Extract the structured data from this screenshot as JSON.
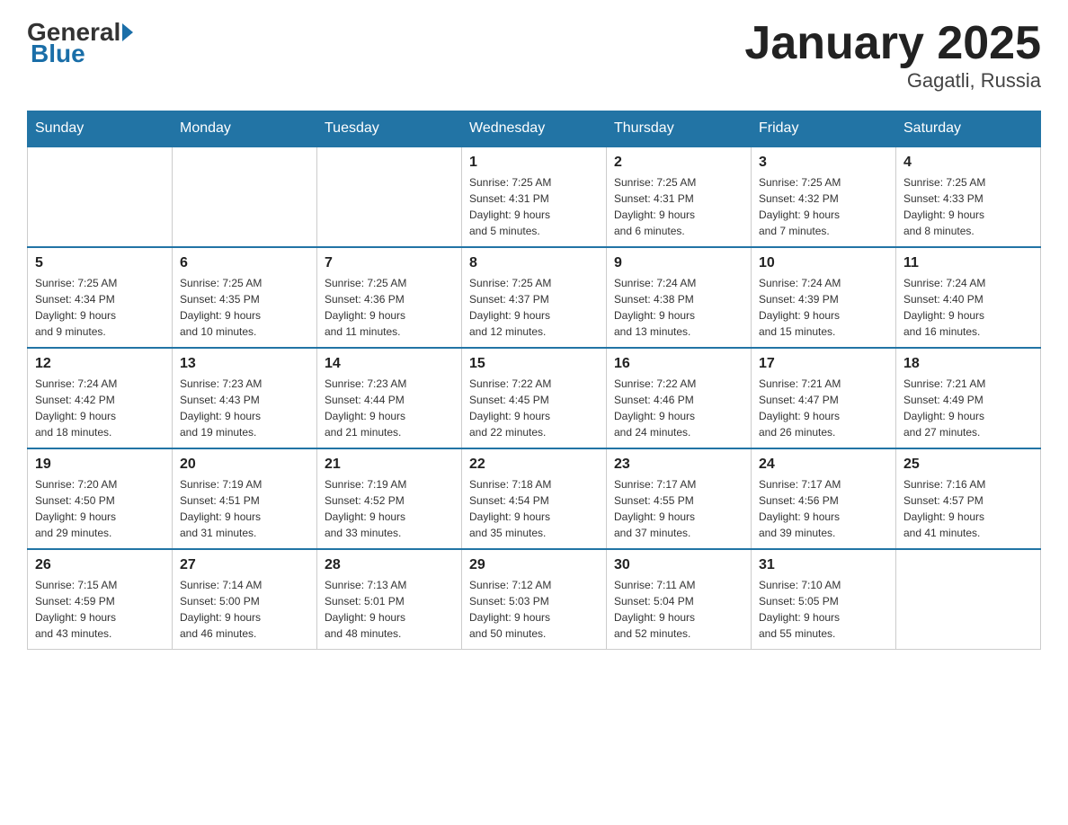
{
  "header": {
    "logo_general": "General",
    "logo_blue": "Blue",
    "month_title": "January 2025",
    "location": "Gagatli, Russia"
  },
  "days_of_week": [
    "Sunday",
    "Monday",
    "Tuesday",
    "Wednesday",
    "Thursday",
    "Friday",
    "Saturday"
  ],
  "weeks": [
    [
      {
        "day": "",
        "info": ""
      },
      {
        "day": "",
        "info": ""
      },
      {
        "day": "",
        "info": ""
      },
      {
        "day": "1",
        "info": "Sunrise: 7:25 AM\nSunset: 4:31 PM\nDaylight: 9 hours\nand 5 minutes."
      },
      {
        "day": "2",
        "info": "Sunrise: 7:25 AM\nSunset: 4:31 PM\nDaylight: 9 hours\nand 6 minutes."
      },
      {
        "day": "3",
        "info": "Sunrise: 7:25 AM\nSunset: 4:32 PM\nDaylight: 9 hours\nand 7 minutes."
      },
      {
        "day": "4",
        "info": "Sunrise: 7:25 AM\nSunset: 4:33 PM\nDaylight: 9 hours\nand 8 minutes."
      }
    ],
    [
      {
        "day": "5",
        "info": "Sunrise: 7:25 AM\nSunset: 4:34 PM\nDaylight: 9 hours\nand 9 minutes."
      },
      {
        "day": "6",
        "info": "Sunrise: 7:25 AM\nSunset: 4:35 PM\nDaylight: 9 hours\nand 10 minutes."
      },
      {
        "day": "7",
        "info": "Sunrise: 7:25 AM\nSunset: 4:36 PM\nDaylight: 9 hours\nand 11 minutes."
      },
      {
        "day": "8",
        "info": "Sunrise: 7:25 AM\nSunset: 4:37 PM\nDaylight: 9 hours\nand 12 minutes."
      },
      {
        "day": "9",
        "info": "Sunrise: 7:24 AM\nSunset: 4:38 PM\nDaylight: 9 hours\nand 13 minutes."
      },
      {
        "day": "10",
        "info": "Sunrise: 7:24 AM\nSunset: 4:39 PM\nDaylight: 9 hours\nand 15 minutes."
      },
      {
        "day": "11",
        "info": "Sunrise: 7:24 AM\nSunset: 4:40 PM\nDaylight: 9 hours\nand 16 minutes."
      }
    ],
    [
      {
        "day": "12",
        "info": "Sunrise: 7:24 AM\nSunset: 4:42 PM\nDaylight: 9 hours\nand 18 minutes."
      },
      {
        "day": "13",
        "info": "Sunrise: 7:23 AM\nSunset: 4:43 PM\nDaylight: 9 hours\nand 19 minutes."
      },
      {
        "day": "14",
        "info": "Sunrise: 7:23 AM\nSunset: 4:44 PM\nDaylight: 9 hours\nand 21 minutes."
      },
      {
        "day": "15",
        "info": "Sunrise: 7:22 AM\nSunset: 4:45 PM\nDaylight: 9 hours\nand 22 minutes."
      },
      {
        "day": "16",
        "info": "Sunrise: 7:22 AM\nSunset: 4:46 PM\nDaylight: 9 hours\nand 24 minutes."
      },
      {
        "day": "17",
        "info": "Sunrise: 7:21 AM\nSunset: 4:47 PM\nDaylight: 9 hours\nand 26 minutes."
      },
      {
        "day": "18",
        "info": "Sunrise: 7:21 AM\nSunset: 4:49 PM\nDaylight: 9 hours\nand 27 minutes."
      }
    ],
    [
      {
        "day": "19",
        "info": "Sunrise: 7:20 AM\nSunset: 4:50 PM\nDaylight: 9 hours\nand 29 minutes."
      },
      {
        "day": "20",
        "info": "Sunrise: 7:19 AM\nSunset: 4:51 PM\nDaylight: 9 hours\nand 31 minutes."
      },
      {
        "day": "21",
        "info": "Sunrise: 7:19 AM\nSunset: 4:52 PM\nDaylight: 9 hours\nand 33 minutes."
      },
      {
        "day": "22",
        "info": "Sunrise: 7:18 AM\nSunset: 4:54 PM\nDaylight: 9 hours\nand 35 minutes."
      },
      {
        "day": "23",
        "info": "Sunrise: 7:17 AM\nSunset: 4:55 PM\nDaylight: 9 hours\nand 37 minutes."
      },
      {
        "day": "24",
        "info": "Sunrise: 7:17 AM\nSunset: 4:56 PM\nDaylight: 9 hours\nand 39 minutes."
      },
      {
        "day": "25",
        "info": "Sunrise: 7:16 AM\nSunset: 4:57 PM\nDaylight: 9 hours\nand 41 minutes."
      }
    ],
    [
      {
        "day": "26",
        "info": "Sunrise: 7:15 AM\nSunset: 4:59 PM\nDaylight: 9 hours\nand 43 minutes."
      },
      {
        "day": "27",
        "info": "Sunrise: 7:14 AM\nSunset: 5:00 PM\nDaylight: 9 hours\nand 46 minutes."
      },
      {
        "day": "28",
        "info": "Sunrise: 7:13 AM\nSunset: 5:01 PM\nDaylight: 9 hours\nand 48 minutes."
      },
      {
        "day": "29",
        "info": "Sunrise: 7:12 AM\nSunset: 5:03 PM\nDaylight: 9 hours\nand 50 minutes."
      },
      {
        "day": "30",
        "info": "Sunrise: 7:11 AM\nSunset: 5:04 PM\nDaylight: 9 hours\nand 52 minutes."
      },
      {
        "day": "31",
        "info": "Sunrise: 7:10 AM\nSunset: 5:05 PM\nDaylight: 9 hours\nand 55 minutes."
      },
      {
        "day": "",
        "info": ""
      }
    ]
  ]
}
